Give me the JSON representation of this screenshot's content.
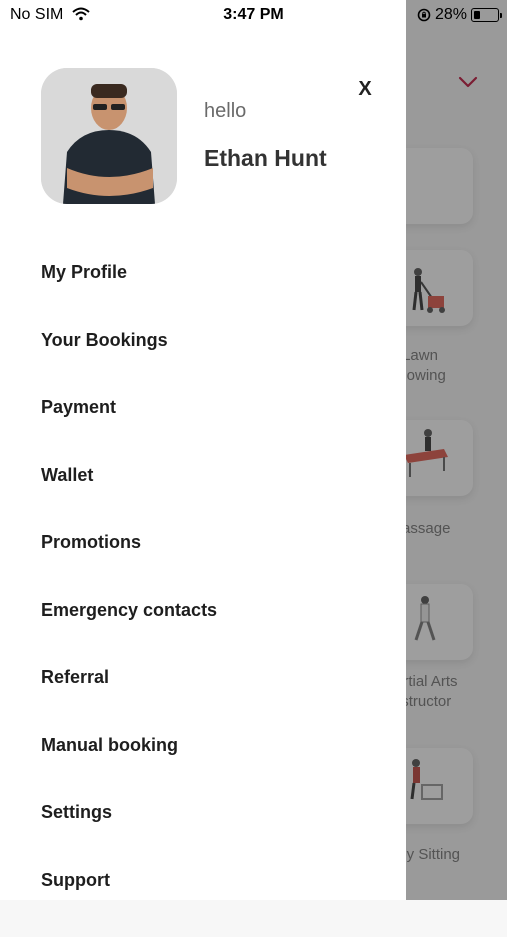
{
  "status_bar": {
    "carrier": "No SIM",
    "time": "3:47 PM",
    "battery": "28%",
    "battery_fraction": 0.28
  },
  "profile": {
    "greeting": "hello",
    "name": "Ethan Hunt"
  },
  "close_label": "X",
  "menu": [
    {
      "label": "My Profile"
    },
    {
      "label": "Your Bookings"
    },
    {
      "label": "Payment"
    },
    {
      "label": "Wallet"
    },
    {
      "label": "Promotions"
    },
    {
      "label": "Emergency contacts"
    },
    {
      "label": "Referral"
    },
    {
      "label": "Manual booking"
    },
    {
      "label": "Settings"
    },
    {
      "label": "Support"
    }
  ],
  "background_services": [
    {
      "line1": "Lawn",
      "line2": "Mowing"
    },
    {
      "line1": "Massage",
      "line2": ""
    },
    {
      "line1": "Martial Arts",
      "line2": "Instructor"
    },
    {
      "line1": "Baby Sitting",
      "line2": ""
    }
  ],
  "colors": {
    "accent": "#c0143c",
    "overlay": "rgba(40,40,40,0.45)"
  }
}
